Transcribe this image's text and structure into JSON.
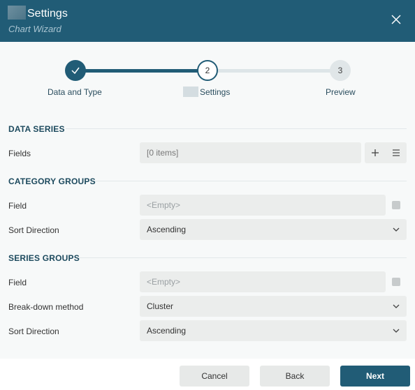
{
  "header": {
    "title": "Settings",
    "subtitle": "Chart Wizard"
  },
  "stepper": {
    "steps": [
      {
        "label": "Data and Type",
        "number": "",
        "status": "complete"
      },
      {
        "label": "Settings",
        "number": "2",
        "status": "current"
      },
      {
        "label": "Preview",
        "number": "3",
        "status": "upcoming"
      }
    ]
  },
  "data_series": {
    "heading": "DATA SERIES",
    "fields_label": "Fields",
    "fields_value": "[0 items]"
  },
  "category_groups": {
    "heading": "CATEGORY GROUPS",
    "field_label": "Field",
    "field_placeholder": "<Empty>",
    "sort_label": "Sort Direction",
    "sort_value": "Ascending"
  },
  "series_groups": {
    "heading": "SERIES GROUPS",
    "field_label": "Field",
    "field_placeholder": "<Empty>",
    "breakdown_label": "Break-down method",
    "breakdown_value": "Cluster",
    "sort_label": "Sort Direction",
    "sort_value": "Ascending"
  },
  "footer": {
    "cancel_label": "Cancel",
    "back_label": "Back",
    "next_label": "Next"
  },
  "colors": {
    "primary": "#215c76",
    "background": "#f7f9f9",
    "field_background": "#ebedec"
  }
}
